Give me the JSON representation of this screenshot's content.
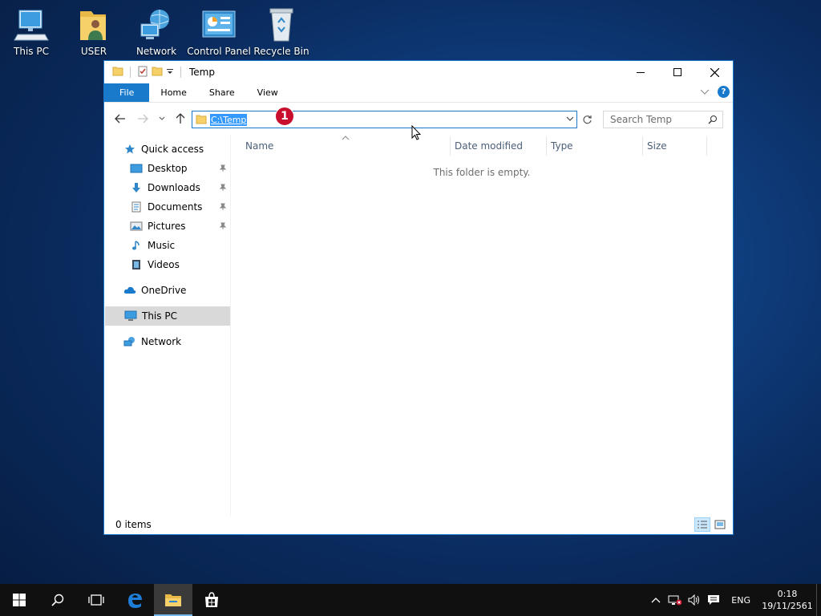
{
  "desktop": {
    "icons": [
      {
        "label": "This PC",
        "icon": "this-pc-icon"
      },
      {
        "label": "USER",
        "icon": "user-folder-icon"
      },
      {
        "label": "Network",
        "icon": "network-icon"
      },
      {
        "label": "Control Panel",
        "icon": "control-panel-icon"
      },
      {
        "label": "Recycle Bin",
        "icon": "recycle-bin-icon"
      }
    ]
  },
  "window": {
    "title": "Temp",
    "ribbon_tabs": [
      "File",
      "Home",
      "Share",
      "View"
    ],
    "address": "C:\\Temp",
    "search_placeholder": "Search Temp",
    "step_badge": "1",
    "nav_pane": {
      "quick_access": "Quick access",
      "pinned": [
        "Desktop",
        "Downloads",
        "Documents",
        "Pictures"
      ],
      "unpinned": [
        "Music",
        "Videos"
      ],
      "onedrive": "OneDrive",
      "this_pc": "This PC",
      "network": "Network"
    },
    "columns": [
      "Name",
      "Date modified",
      "Type",
      "Size"
    ],
    "empty_message": "This folder is empty.",
    "status": "0 items",
    "accent": "#1979ca"
  },
  "taskbar": {
    "language": "ENG",
    "time": "0:18",
    "date": "19/11/2561"
  }
}
